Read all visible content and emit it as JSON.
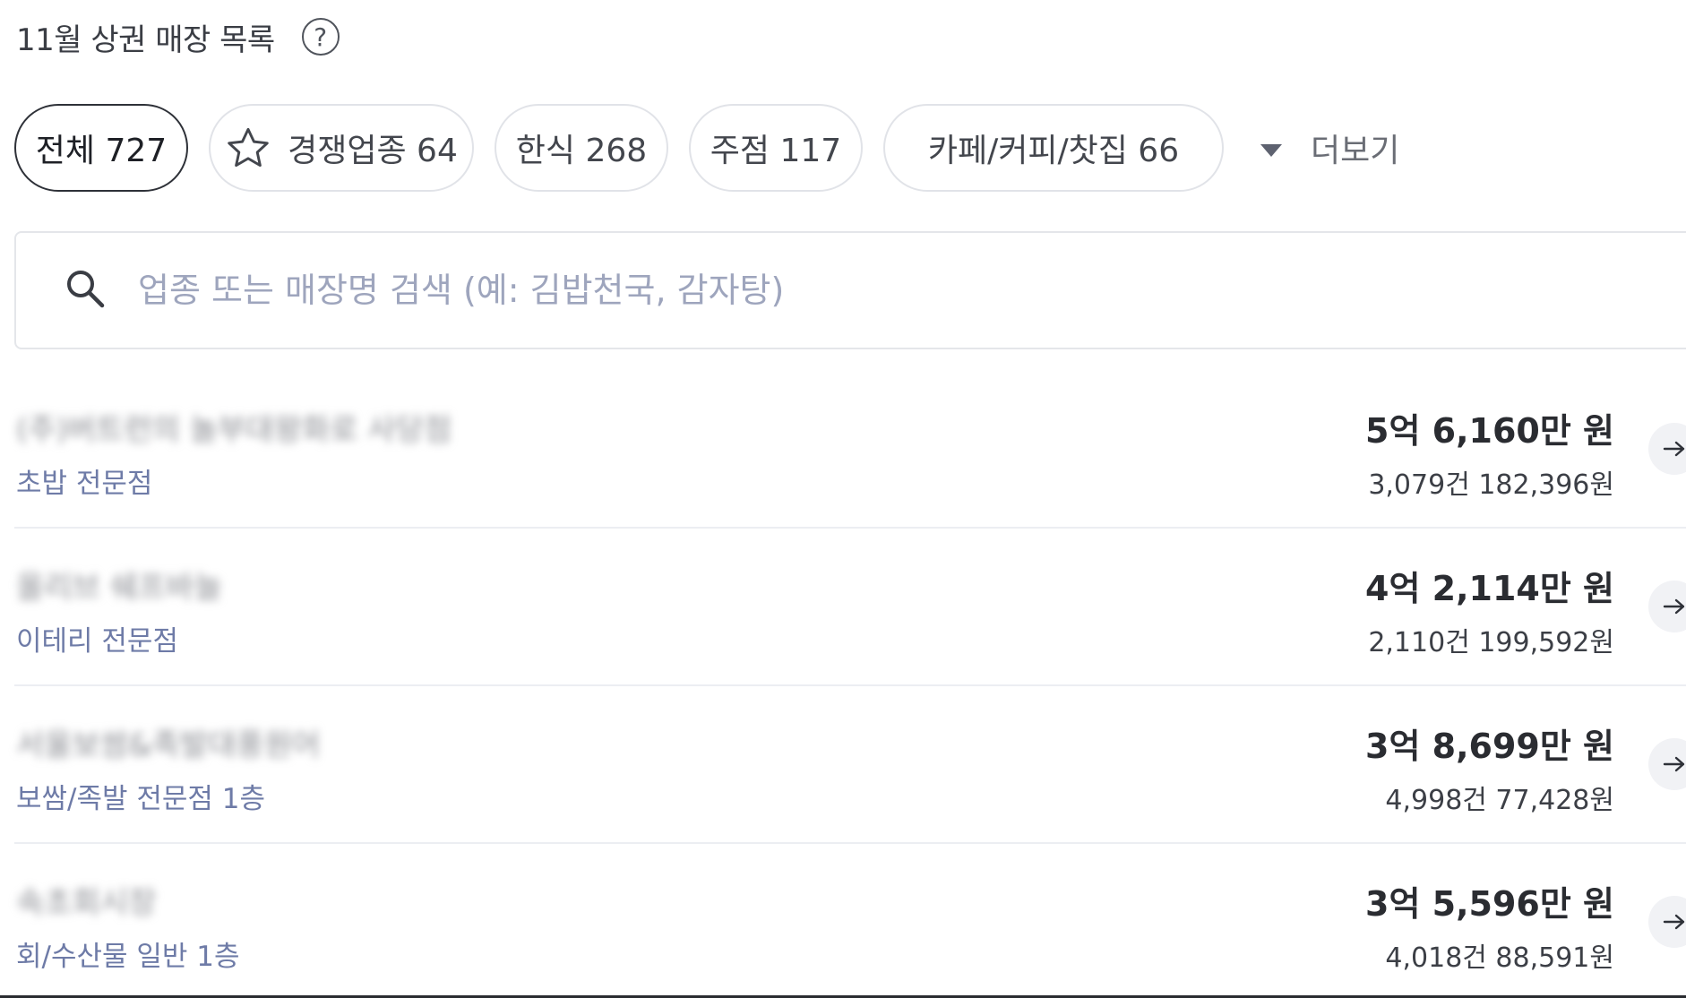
{
  "header": {
    "title": "11월 상권 매장 목록",
    "help_icon": "question-circle-icon"
  },
  "filters": {
    "chips": [
      {
        "label": "전체 727",
        "active": true
      },
      {
        "label": "경쟁업종 64",
        "icon": "star-outline-icon",
        "active": false
      },
      {
        "label": "한식 268",
        "active": false
      },
      {
        "label": "주점 117",
        "active": false
      },
      {
        "label": "카페/커피/찻집 66",
        "active": false
      }
    ],
    "more_label": "더보기",
    "more_icon": "caret-down-icon"
  },
  "search": {
    "placeholder": "업종 또는 매장명 검색 (예: 김밥천국, 감자탕)",
    "icon": "search-icon"
  },
  "stores": [
    {
      "name": "(주)버트런의 놀부대왕화로 사당점",
      "category": "초밥 전문점",
      "sales": "5억 6,160만 원",
      "detail": "3,079건 182,396원"
    },
    {
      "name": "올리브 쉐프바늘",
      "category": "이테리 전문점",
      "sales": "4억 2,114만 원",
      "detail": "2,110건 199,592원"
    },
    {
      "name": "서울보쌈&족발대풍원어",
      "category": "보쌈/족발 전문점 1층",
      "sales": "3억 8,699만 원",
      "detail": "4,998건 77,428원"
    },
    {
      "name": "속초회시장",
      "category": "회/수산물 일반 1층",
      "sales": "3억 5,596만 원",
      "detail": "4,018건 88,591원"
    }
  ],
  "colors": {
    "accent_text": "#6e7ba7",
    "chip_border": "#e1e3e8",
    "active_chip_border": "#2e3138",
    "placeholder": "#9ea5bd"
  }
}
